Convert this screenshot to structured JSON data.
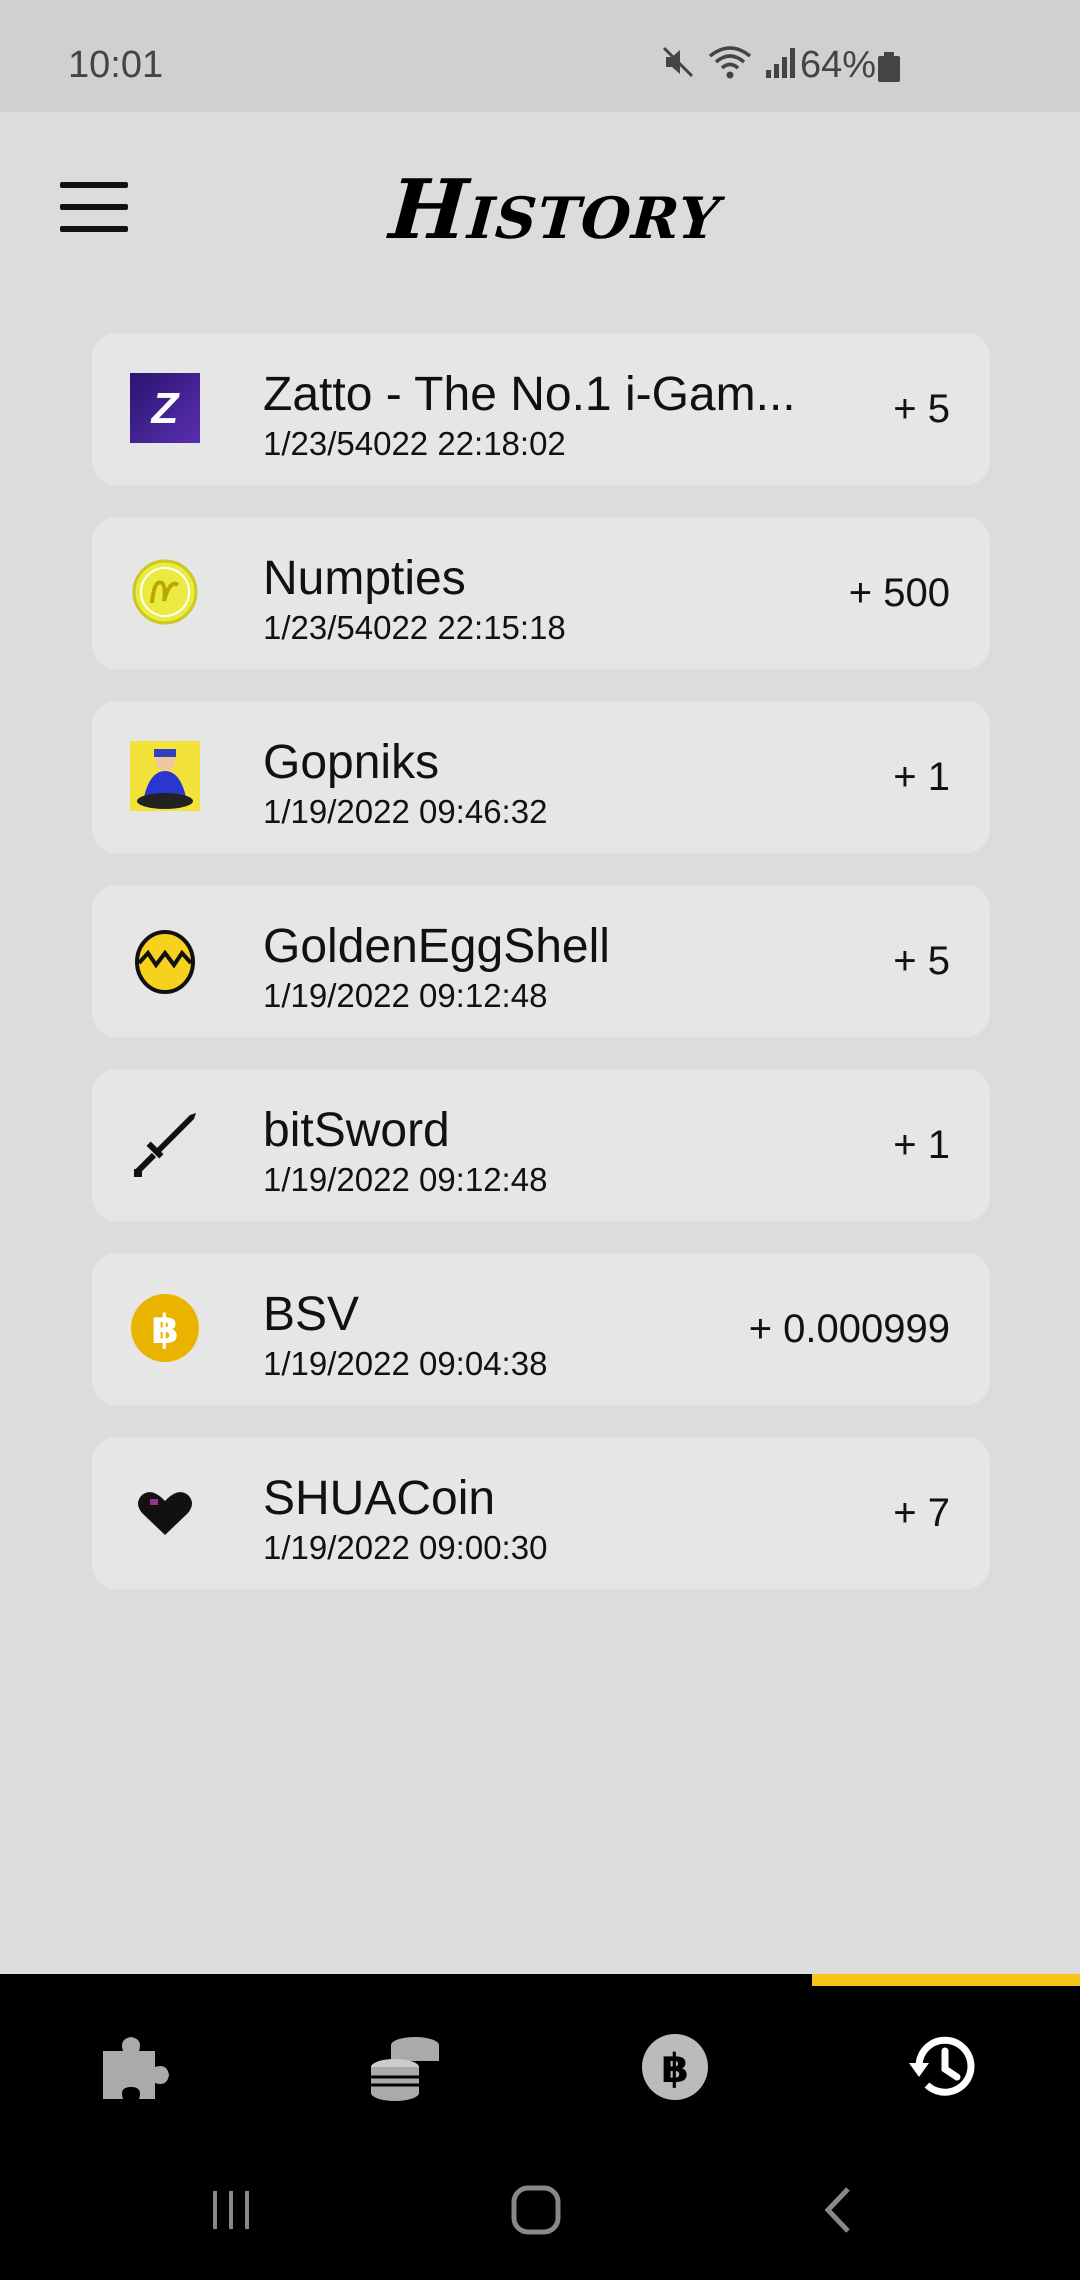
{
  "status_bar": {
    "time": "10:01",
    "battery": "64%",
    "icons": [
      "mute-icon",
      "wifi-icon",
      "signal-icon",
      "battery-icon"
    ]
  },
  "header": {
    "title": "History",
    "menu_icon": "hamburger-menu-icon"
  },
  "history": [
    {
      "name": "Zatto - The No.1 i-Gam...",
      "date": "1/23/54022 22:18:02",
      "amount": "+ 5",
      "icon": "zatto-icon",
      "color": "#3a1f8f"
    },
    {
      "name": "Numpties",
      "date": "1/23/54022 22:15:18",
      "amount": "+ 500",
      "icon": "numpties-icon",
      "color": "#e8e83a"
    },
    {
      "name": "Gopniks",
      "date": "1/19/2022 09:46:32",
      "amount": "+ 1",
      "icon": "gopniks-icon",
      "color": "#f3e23a"
    },
    {
      "name": "GoldenEggShell",
      "date": "1/19/2022 09:12:48",
      "amount": "+ 5",
      "icon": "golden-egg-icon",
      "color": "#f6d21f"
    },
    {
      "name": "bitSword",
      "date": "1/19/2022 09:12:48",
      "amount": "+ 1",
      "icon": "sword-icon",
      "color": "#111111"
    },
    {
      "name": "BSV",
      "date": "1/19/2022 09:04:38",
      "amount": "+ 0.000999",
      "icon": "bitcoin-icon",
      "color": "#eab300"
    },
    {
      "name": "SHUACoin",
      "date": "1/19/2022 09:00:30",
      "amount": "+ 7",
      "icon": "heart-icon",
      "color": "#111111"
    }
  ],
  "bottom_nav": {
    "tabs": [
      {
        "icon": "puzzle-icon",
        "active": false
      },
      {
        "icon": "coins-icon",
        "active": false
      },
      {
        "icon": "bitcoin-icon",
        "active": false
      },
      {
        "icon": "history-icon",
        "active": true
      }
    ],
    "accent": "#f5c518"
  },
  "system_nav": {
    "buttons": [
      "recents-icon",
      "home-icon",
      "back-icon"
    ]
  }
}
